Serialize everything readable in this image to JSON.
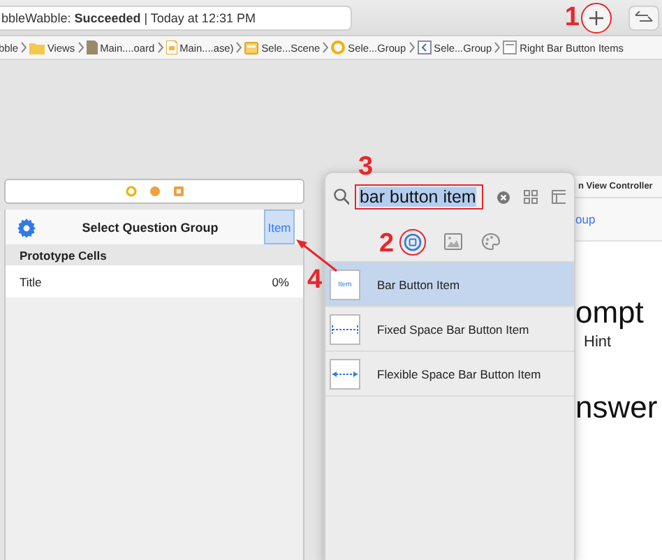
{
  "toolbar": {
    "status": "bbleWabble: **Succeeded** | Today at 12:31 PM",
    "add_button": {
      "callout": "1"
    }
  },
  "breadcrumbs": [
    {
      "label": "bble",
      "kind": "none"
    },
    {
      "label": "Views",
      "kind": "folder"
    },
    {
      "label": "Main....oard",
      "kind": "storyboard"
    },
    {
      "label": "Main....ase)",
      "kind": "file"
    },
    {
      "label": "Sele...Scene",
      "kind": "scene"
    },
    {
      "label": "Sele...Group",
      "kind": "controller"
    },
    {
      "label": "Sele...Group",
      "kind": "navitem"
    },
    {
      "label": "Right Bar Button Items",
      "kind": "list"
    }
  ],
  "scene_left": {
    "nav_title": "Select Question Group",
    "bar_item": {
      "label": "Item",
      "selected": true,
      "callout": "4"
    },
    "section_header": "Prototype Cells",
    "cells": [
      {
        "title": "Title",
        "detail": "0%"
      }
    ]
  },
  "scene_right": {
    "header": "n View Controller",
    "nav_item": "oup",
    "texts": [
      {
        "text": "ompt",
        "kind": "large"
      },
      {
        "text": "Hint",
        "kind": "small"
      },
      {
        "text": "nswer",
        "kind": "large"
      }
    ]
  },
  "library": {
    "search": {
      "value": "bar button item",
      "callout": "3"
    },
    "tabs": [
      {
        "kind": "objects",
        "selected": true,
        "callout": "2"
      },
      {
        "kind": "media",
        "selected": false
      },
      {
        "kind": "colors",
        "selected": false
      }
    ],
    "items": [
      {
        "label": "Bar Button Item",
        "kind": "item",
        "thumb_label": "Item",
        "selected": true
      },
      {
        "label": "Fixed Space Bar Button Item",
        "kind": "fixed",
        "selected": false
      },
      {
        "label": "Flexible Space Bar Button Item",
        "kind": "flexible",
        "selected": false
      }
    ]
  }
}
